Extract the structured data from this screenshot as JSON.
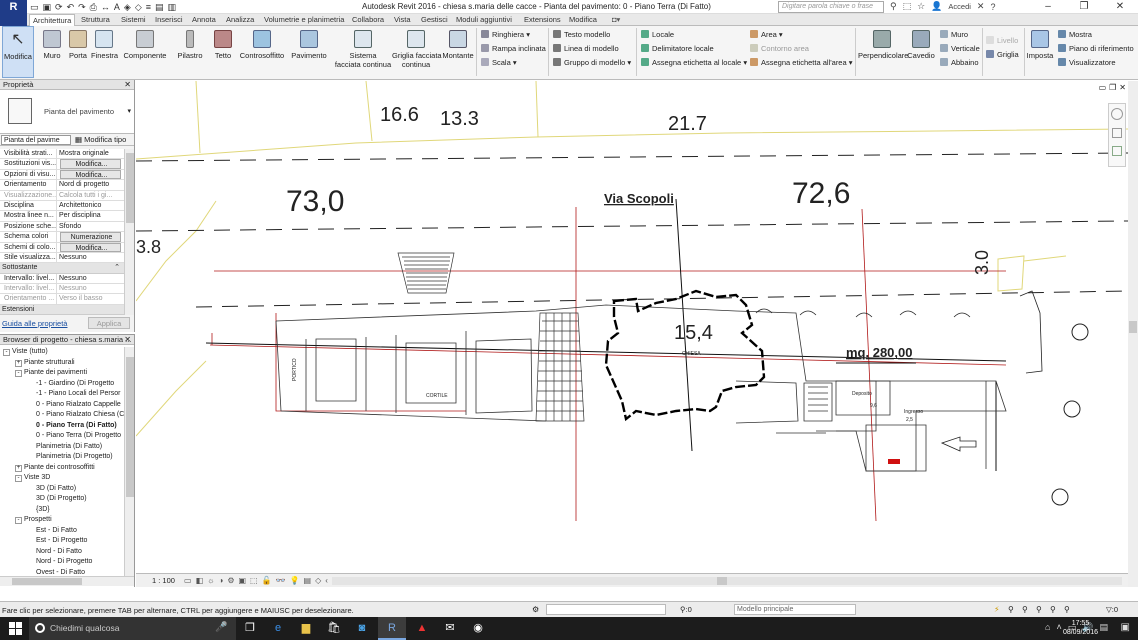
{
  "titlebar": {
    "app_logo": "R",
    "doc_title": "Autodesk Revit 2016 -     chiesa s.maria delle cacce - Pianta del pavimento: 0 - Piano Terra (Di Fatto)",
    "search_placeholder": "Digitare parola chiave o frase",
    "login_label": "Accedi"
  },
  "ribbon_tabs": [
    "Architettura",
    "Struttura",
    "Sistemi",
    "Inserisci",
    "Annota",
    "Analizza",
    "Volumetrie e planimetria",
    "Collabora",
    "Vista",
    "Gestisci",
    "Moduli aggiuntivi",
    "Extensions",
    "Modifica"
  ],
  "ribbon": {
    "modifica": "Modifica",
    "muro": "Muro",
    "porta": "Porta",
    "finestra": "Finestra",
    "componente": "Componente",
    "pilastro": "Pilastro",
    "tetto": "Tetto",
    "controsoffitto": "Controsoffitto",
    "pavimento": "Pavimento",
    "sistema_facciata": "Sistema",
    "sistema_facciata_2": "facciata continua",
    "griglia_facciata": "Griglia facciata",
    "griglia_facciata_2": "continua",
    "montante": "Montante",
    "ringhiera": "Ringhiera",
    "rampa": "Rampa inclinata",
    "scala": "Scala",
    "testo_modello": "Testo modello",
    "linea_modello": "Linea di modello",
    "gruppo_modello": "Gruppo di modello",
    "locale": "Locale",
    "delimitatore": "Delimitatore  locale",
    "assegna_etichetta_locale": "Assegna etichetta  al locale",
    "area": "Area",
    "contorno_area": "Contorno  area",
    "assegna_etichetta_area": "Assegna etichetta  all'area",
    "perpendicolare": "Perpendicolare",
    "cavedio": "Cavedio",
    "muro_small": "Muro",
    "verticale": "Verticale",
    "abbaino": "Abbaino",
    "livello": "Livello",
    "griglia": "Griglia",
    "imposta": "Imposta",
    "mostra": "Mostra",
    "piano_riferimento": "Piano di riferimento",
    "visualizzatore": "Visualizzatore"
  },
  "properties": {
    "header": "Proprietà",
    "type_name": "Pianta del pavimento",
    "filter": "Pianta del pavime",
    "edit_type": "Modifica tipo",
    "rows": [
      {
        "k": "Visibilità strati...",
        "v": "Mostra originale",
        "kind": "text"
      },
      {
        "k": "Sostituzioni vis...",
        "v": "Modifica...",
        "kind": "btn"
      },
      {
        "k": "Opzioni di visu...",
        "v": "Modifica...",
        "kind": "btn"
      },
      {
        "k": "Orientamento",
        "v": "Nord di progetto",
        "kind": "text"
      },
      {
        "k": "Visualizzazione...",
        "v": "Calcola tutti i gi...",
        "kind": "dim"
      },
      {
        "k": "Disciplina",
        "v": "Architettonico",
        "kind": "text"
      },
      {
        "k": "Mostra linee n...",
        "v": "Per disciplina",
        "kind": "text"
      },
      {
        "k": "Posizione sche...",
        "v": "Sfondo",
        "kind": "text"
      },
      {
        "k": "Schema colori",
        "v": "Numerazione",
        "kind": "btn"
      },
      {
        "k": "Schemi di colo...",
        "v": "Modifica...",
        "kind": "btn"
      },
      {
        "k": "Stile visualizza...",
        "v": "Nessuno",
        "kind": "text"
      }
    ],
    "section2": "Sottostante",
    "rows2": [
      {
        "k": "Intervallo: livel...",
        "v": "Nessuno",
        "kind": "text"
      },
      {
        "k": "Intervallo: livel...",
        "v": "Nessuno",
        "kind": "dim"
      },
      {
        "k": "Orientamento ...",
        "v": "Verso il basso",
        "kind": "dim"
      }
    ],
    "section3": "Estensioni",
    "help_link": "Guida alle proprietà",
    "apply": "Applica"
  },
  "browser": {
    "header": "Browser di progetto - chiesa s.maria ...",
    "items": [
      {
        "t": "Viste (tutto)",
        "lvl": 0,
        "tog": "-"
      },
      {
        "t": "Piante strutturali",
        "lvl": 1,
        "tog": "+"
      },
      {
        "t": "Piante dei pavimenti",
        "lvl": 1,
        "tog": "-"
      },
      {
        "t": "-1 - Giardino (Di Progetto",
        "lvl": 2,
        "tog": ""
      },
      {
        "t": "-1 - Piano Locali del Persor",
        "lvl": 2,
        "tog": ""
      },
      {
        "t": "0 - Piano Rialzato Cappelle",
        "lvl": 2,
        "tog": ""
      },
      {
        "t": "0 - Piano Rialzato Chiesa (C",
        "lvl": 2,
        "tog": ""
      },
      {
        "t": "0 - Piano Terra (Di Fatto)",
        "lvl": 2,
        "tog": "",
        "bold": true
      },
      {
        "t": "0 - Piano Terra (Di Progetto",
        "lvl": 2,
        "tog": ""
      },
      {
        "t": "Planimetria (Di Fatto)",
        "lvl": 2,
        "tog": ""
      },
      {
        "t": "Planimetria (Di Progetto)",
        "lvl": 2,
        "tog": ""
      },
      {
        "t": "Piante dei controsoffitti",
        "lvl": 1,
        "tog": "+"
      },
      {
        "t": "Viste 3D",
        "lvl": 1,
        "tog": "-"
      },
      {
        "t": "3D (Di Fatto)",
        "lvl": 2,
        "tog": ""
      },
      {
        "t": "3D (Di Progetto)",
        "lvl": 2,
        "tog": ""
      },
      {
        "t": "{3D}",
        "lvl": 2,
        "tog": ""
      },
      {
        "t": "Prospetti",
        "lvl": 1,
        "tog": "-"
      },
      {
        "t": "Est - Di Fatto",
        "lvl": 2,
        "tog": ""
      },
      {
        "t": "Est - Di Progetto",
        "lvl": 2,
        "tog": ""
      },
      {
        "t": "Nord - Di Fatto",
        "lvl": 2,
        "tog": ""
      },
      {
        "t": "Nord - Di Progetto",
        "lvl": 2,
        "tog": ""
      },
      {
        "t": "Ovest - Di Fatto",
        "lvl": 2,
        "tog": ""
      }
    ]
  },
  "drawing": {
    "labels": {
      "n166": "16.6",
      "n133": "13.3",
      "n217": "21.7",
      "n730": "73,0",
      "n726": "72,6",
      "n38": "3.8",
      "n30": "3.0",
      "street": "Via Scopoli",
      "n154": "15,4",
      "area": "mq. 280,00",
      "chiesa": "CHIESA",
      "portico": "PORTICO",
      "cortile": "CORTILE",
      "deposito": "Deposito",
      "deposito_val": "9,6",
      "ingresso": "Ingresso",
      "ingresso_val": "2,5"
    }
  },
  "viewbar": {
    "scale": "1 : 100"
  },
  "statusbar": {
    "text": "Fare clic per selezionare, premere TAB per alternare, CTRL per aggiungere e MAIUSC per deselezionare.",
    "sel_count": ":0",
    "model": "Modello principale",
    "filter_count": ":0"
  },
  "taskbar": {
    "search": "Chiedimi qualcosa",
    "time": "17:55",
    "date": "08/09/2016"
  },
  "colors": {
    "accent": "#1f3c88",
    "drawing_red": "#b01818",
    "drawing_yellow": "#e8e08a"
  }
}
